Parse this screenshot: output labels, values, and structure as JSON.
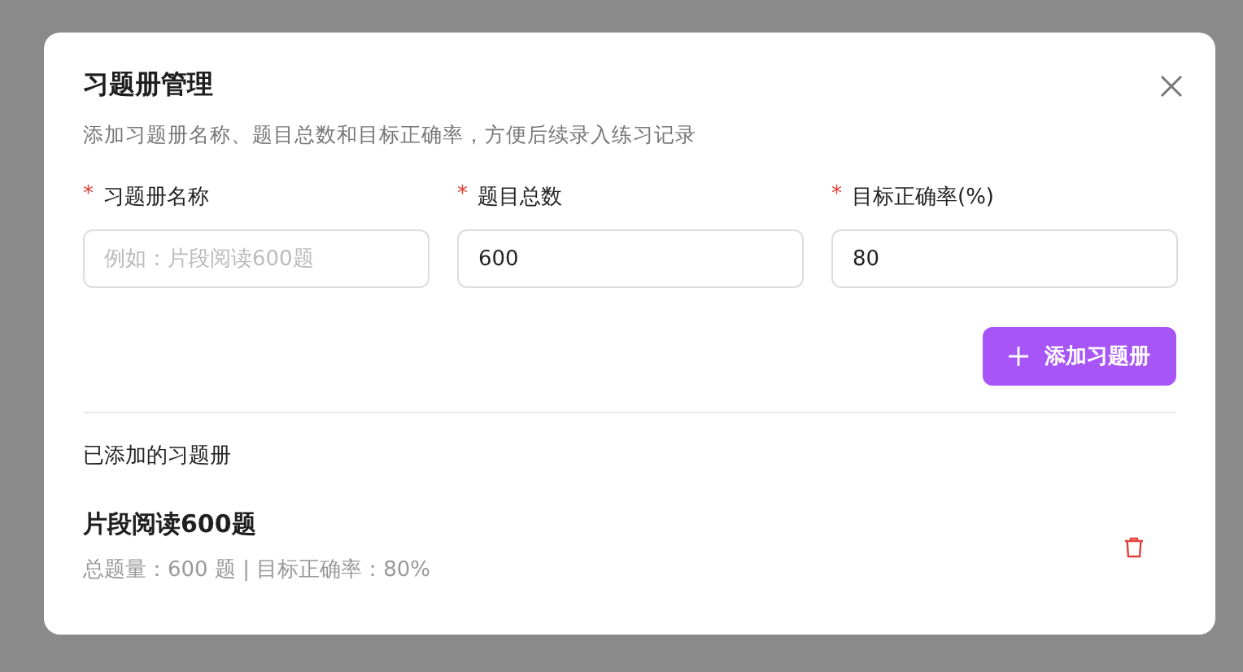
{
  "dialog": {
    "title": "习题册管理",
    "subtitle": "添加习题册名称、题目总数和目标正确率，方便后续录入练习记录",
    "fields": [
      {
        "label": "习题册名称",
        "required_mark": "*",
        "placeholder": "例如：片段阅读600题"
      },
      {
        "label": "题目总数",
        "required_mark": "*",
        "value": "600"
      },
      {
        "label": "目标正确率(%)",
        "required_mark": "*",
        "value": "80"
      }
    ],
    "add_button": "添加习题册",
    "section_title": "已添加的习题册",
    "books": [
      {
        "name": "片段阅读600题",
        "details": "总题量：600 题 | 目标正确率：80%"
      }
    ]
  }
}
